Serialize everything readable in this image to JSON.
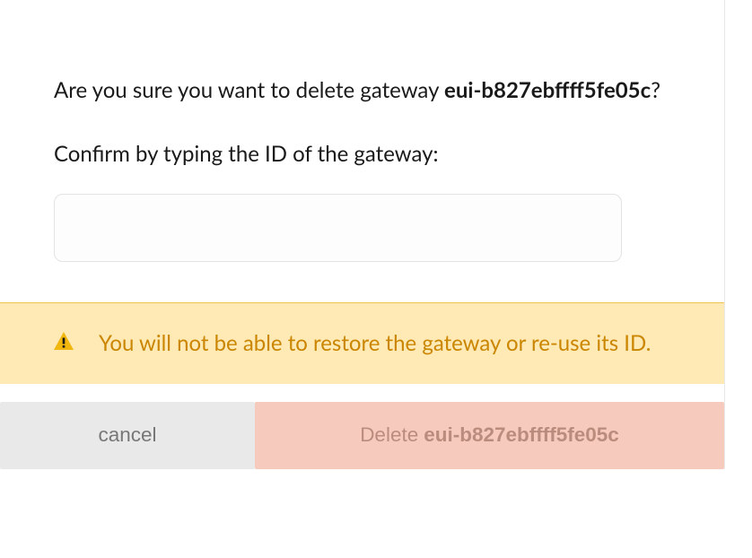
{
  "dialog": {
    "prompt_prefix": "Are you sure you want to delete gateway ",
    "gateway_id": "eui-b827ebffff5fe05c",
    "prompt_suffix": "?",
    "confirm_label": "Confirm by typing the ID of the gateway:",
    "input_value": ""
  },
  "warning": {
    "text": "You will not be able to restore the gateway or re-use its ID."
  },
  "buttons": {
    "cancel_label": "cancel",
    "delete_prefix": "Delete ",
    "delete_id": "eui-b827ebffff5fe05c"
  }
}
